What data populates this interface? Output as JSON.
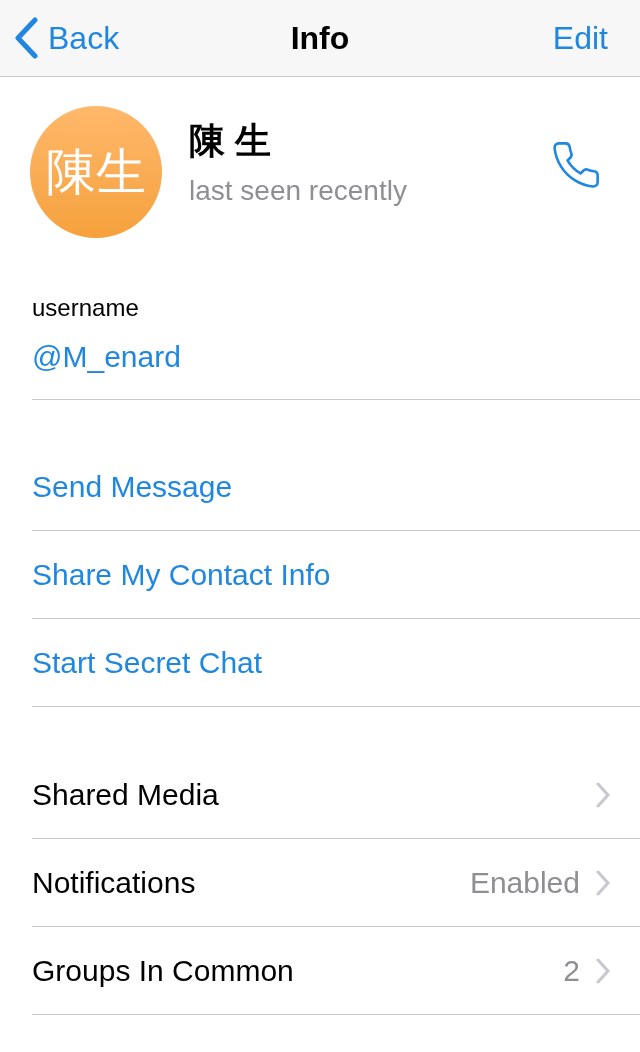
{
  "nav": {
    "back": "Back",
    "title": "Info",
    "edit": "Edit"
  },
  "profile": {
    "avatar_text": "陳生",
    "name": "陳 生",
    "status": "last seen recently"
  },
  "username": {
    "label": "username",
    "value": "@M_enard"
  },
  "actions": [
    "Send Message",
    "Share My Contact Info",
    "Start Secret Chat"
  ],
  "settings": [
    {
      "label": "Shared Media"
    },
    {
      "label": "Notifications",
      "value": "Enabled"
    },
    {
      "label": "Groups In Common",
      "value": "2"
    }
  ]
}
